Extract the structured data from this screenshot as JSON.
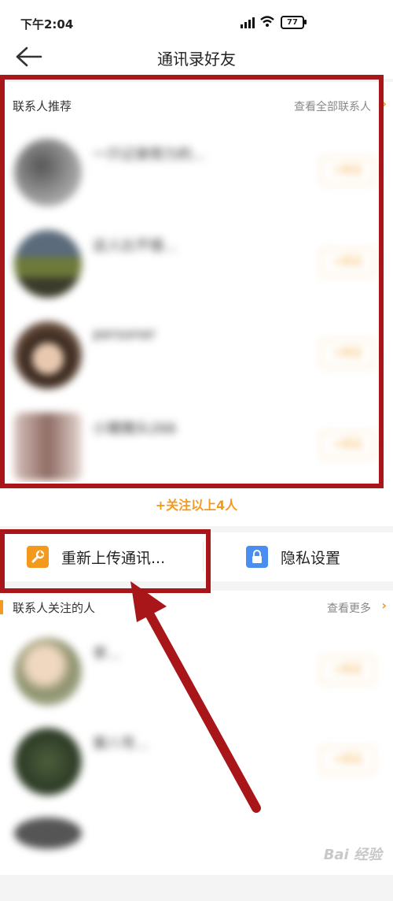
{
  "status": {
    "time": "下午2:04",
    "battery": "77"
  },
  "nav": {
    "title": "通讯录好友"
  },
  "recommend": {
    "title": "联系人推荐",
    "view_all": "查看全部联系人",
    "items": [
      {
        "name": "一只记录努力的...",
        "line2": "",
        "line3": "",
        "follow": "+关注"
      },
      {
        "name": "这人比不错...",
        "line2": "",
        "line3": "",
        "follow": "+关注"
      },
      {
        "name": "personer",
        "line2": "",
        "line3": "",
        "follow": "+关注"
      },
      {
        "name": "小猪猪头266",
        "line2": "",
        "line3": "",
        "follow": "+关注"
      }
    ]
  },
  "follow_all": "+关注以上4人",
  "actions": {
    "reupload": "重新上传通讯...",
    "privacy": "隐私设置"
  },
  "following": {
    "title": "联系人关注的人",
    "view_more": "查看更多",
    "items": [
      {
        "name": "李...",
        "line2": "",
        "line3": "",
        "follow": "+关注"
      },
      {
        "name": "第八号...",
        "line2": "",
        "line3": "",
        "follow": "+关注"
      }
    ]
  },
  "watermark": "Bai 经验",
  "colors": {
    "accent": "#f39a1e",
    "annotation": "#a9161a",
    "privacy_icon": "#4b8ef1"
  }
}
